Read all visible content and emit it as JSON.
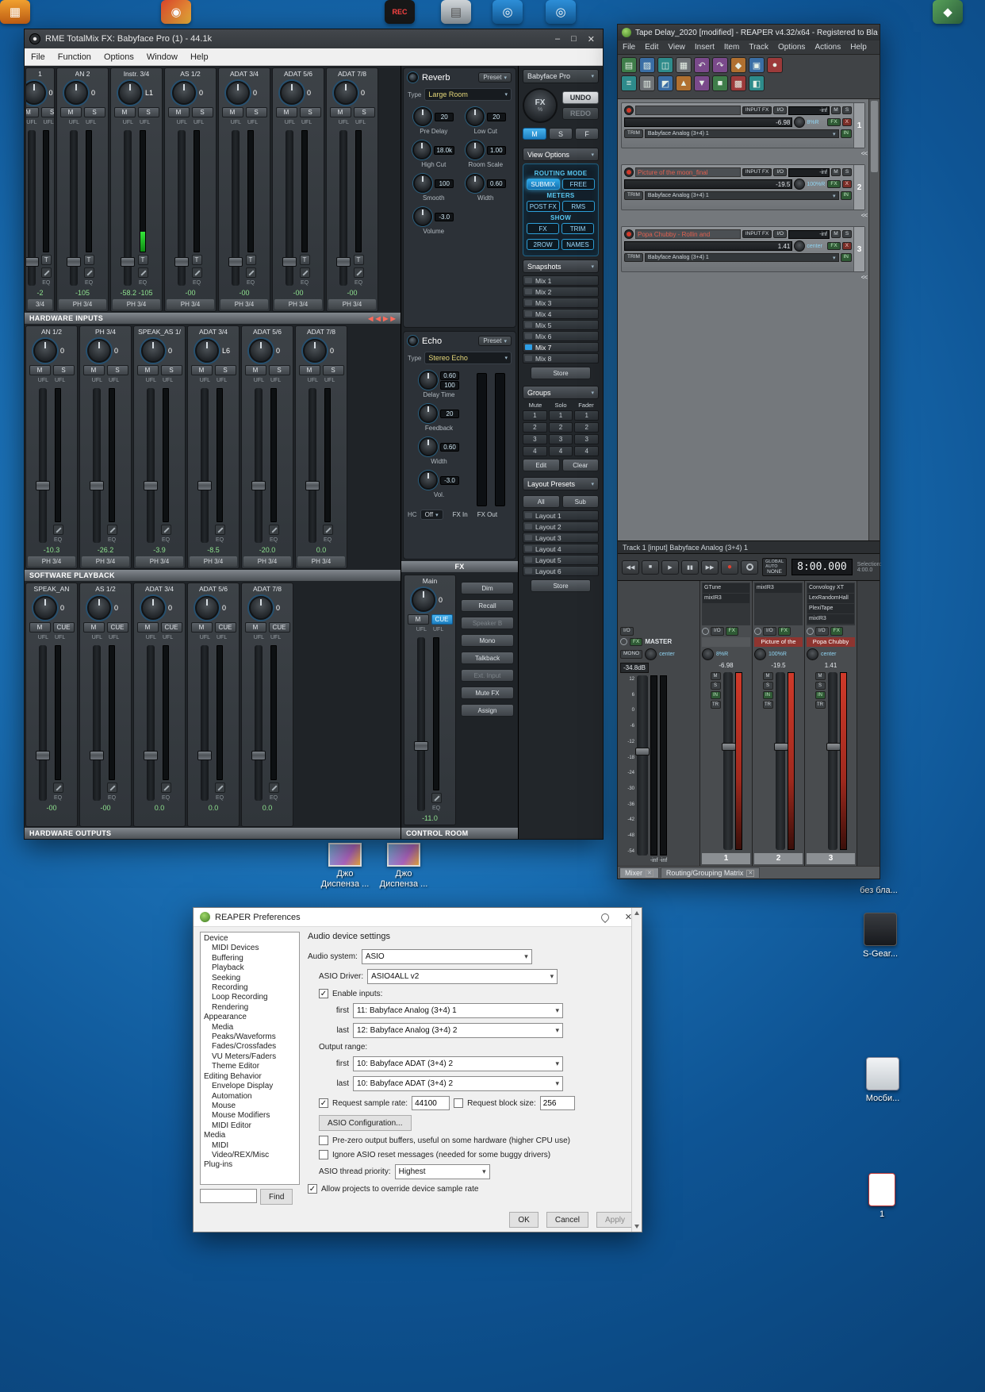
{
  "desktop": {
    "top_icons": [
      {
        "g": "◉",
        "cls": "dk-red"
      },
      {
        "g": "REC",
        "cls": "dk-black"
      },
      {
        "g": "▤",
        "cls": "dk-gray"
      },
      {
        "g": "◎",
        "cls": "dk-blue"
      },
      {
        "g": "◎",
        "cls": "dk-blue"
      },
      {
        "g": "◆",
        "cls": "dk-green"
      },
      {
        "g": "▦",
        "cls": "dk-orange"
      }
    ],
    "files": [
      {
        "label": "Джо Диспенза ..."
      },
      {
        "label": "Джо Диспенза ..."
      }
    ],
    "right_items": [
      {
        "label": "без бла..."
      },
      {
        "label": "S-Gear..."
      },
      {
        "label": "Мосби..."
      },
      {
        "label": "1"
      }
    ]
  },
  "totalmix": {
    "title": "RME TotalMix FX: Babyface Pro (1) - 44.1k",
    "window_buttons": [
      "–",
      "□",
      "✕"
    ],
    "menu": [
      "File",
      "Function",
      "Options",
      "Window",
      "Help"
    ],
    "labels": {
      "ufl": "UFL",
      "eq": "EQ",
      "t": "T",
      "m": "M",
      "s": "S",
      "cue": "CUE"
    },
    "sections": {
      "inputs": "HARDWARE INPUTS",
      "playback": "SOFTWARE PLAYBACK",
      "outputs": "HARDWARE OUTPUTS",
      "fx": "FX",
      "control_room": "CONTROL ROOM"
    },
    "input_channels": [
      {
        "name": "1",
        "gain": "0",
        "db": "-2",
        "out": "3/4",
        "cls": "cut"
      },
      {
        "name": "AN 2",
        "gain": "0",
        "db": "-105",
        "out": "PH 3/4"
      },
      {
        "name": "Instr. 3/4",
        "gain": "L1",
        "db": "-58.2 -105",
        "out": "PH 3/4",
        "cls": "lit"
      },
      {
        "name": "AS 1/2",
        "gain": "0",
        "db": "-00",
        "out": "PH 3/4"
      },
      {
        "name": "ADAT 3/4",
        "gain": "0",
        "db": "-00",
        "out": "PH 3/4"
      },
      {
        "name": "ADAT 5/6",
        "gain": "0",
        "db": "-00",
        "out": "PH 3/4"
      },
      {
        "name": "ADAT 7/8",
        "gain": "0",
        "db": "-00",
        "out": "PH 3/4"
      }
    ],
    "playback_channels": [
      {
        "name": "AN 1/2",
        "gain": "0",
        "db": "-10.3",
        "out": "PH 3/4"
      },
      {
        "name": "PH 3/4",
        "gain": "0",
        "db": "-26.2",
        "out": "PH 3/4"
      },
      {
        "name": "SPEAK_AS 1/",
        "gain": "0",
        "db": "-3.9",
        "out": "PH 3/4"
      },
      {
        "name": "ADAT 3/4",
        "gain": "L6",
        "db": "-8.5",
        "out": "PH 3/4"
      },
      {
        "name": "ADAT 5/6",
        "gain": "0",
        "db": "-20.0",
        "out": "PH 3/4"
      },
      {
        "name": "ADAT 7/8",
        "gain": "0",
        "db": "0.0",
        "out": "PH 3/4"
      }
    ],
    "output_channels": [
      {
        "name": "SPEAK_AN",
        "gain": "0",
        "db": "-00",
        "out": ""
      },
      {
        "name": "AS 1/2",
        "gain": "0",
        "db": "-00",
        "out": ""
      },
      {
        "name": "ADAT 3/4",
        "gain": "0",
        "db": "0.0",
        "out": ""
      },
      {
        "name": "ADAT 5/6",
        "gain": "0",
        "db": "0.0",
        "out": ""
      },
      {
        "name": "ADAT 7/8",
        "gain": "0",
        "db": "0.0",
        "out": ""
      }
    ],
    "reverb": {
      "title": "Reverb",
      "preset": "Preset",
      "type_label": "Type",
      "type": "Large Room",
      "knobs": [
        {
          "v": "20",
          "label": "Pre Delay"
        },
        {
          "v": "20",
          "label": "Low Cut"
        },
        {
          "v": "18.0k",
          "label": "High Cut"
        },
        {
          "v": "1.00",
          "label": "Room Scale"
        },
        {
          "v": "100",
          "label": "Smooth"
        },
        {
          "v": "0.60",
          "label": "Width"
        },
        {
          "v": "-3.0",
          "label": "Volume"
        }
      ]
    },
    "echo": {
      "title": "Echo",
      "preset": "Preset",
      "type_label": "Type",
      "type": "Stereo Echo",
      "knobs": [
        {
          "v": "0.60",
          "v2": "100",
          "label": "Delay Time"
        },
        {
          "v": "20",
          "label": "Feedback"
        },
        {
          "v": "0.60",
          "label": "Width"
        },
        {
          "v": "-3.0",
          "label": "Vol."
        }
      ],
      "hc_label": "HC",
      "hc": "Off",
      "meter_in": "FX In",
      "meter_out": "FX Out"
    },
    "control_room": {
      "name": "Main",
      "gain": "0",
      "db": "-11.0",
      "buttons": [
        {
          "label": "Dim"
        },
        {
          "label": "Recall"
        },
        {
          "label": "Speaker B",
          "cls": "dis"
        },
        {
          "label": "Mono"
        },
        {
          "label": "Talkback"
        },
        {
          "label": "Ext. Input",
          "cls": "dis"
        },
        {
          "label": "Mute FX"
        },
        {
          "label": "Assign"
        }
      ]
    },
    "right": {
      "device": "Babyface Pro",
      "fx": "FX",
      "pct": "%",
      "undo": "UNDO",
      "redo": "REDO",
      "msf": [
        {
          "label": "M",
          "cls": "active"
        },
        {
          "label": "S"
        },
        {
          "label": "F"
        }
      ],
      "view_options": "View Options",
      "routing_mode": "ROUTING MODE",
      "routing": [
        {
          "label": "SUBMIX",
          "cls": "active"
        },
        {
          "label": "FREE"
        }
      ],
      "meters_label": "METERS",
      "meters": [
        {
          "label": "POST FX"
        },
        {
          "label": "RMS"
        }
      ],
      "show_label": "SHOW",
      "show": [
        {
          "label": "FX",
          "cls": "half"
        },
        {
          "label": "TRIM",
          "cls": "half"
        },
        {
          "label": "2ROW",
          "cls": "half"
        },
        {
          "label": "NAMES",
          "cls": "half"
        }
      ],
      "snapshots": "Snapshots",
      "mixes": [
        {
          "label": "Mix 1"
        },
        {
          "label": "Mix 2"
        },
        {
          "label": "Mix 3"
        },
        {
          "label": "Mix 4"
        },
        {
          "label": "Mix 5"
        },
        {
          "label": "Mix 6"
        },
        {
          "label": "Mix 7",
          "cls": "sel"
        },
        {
          "label": "Mix 8"
        }
      ],
      "store": "Store",
      "groups": "Groups",
      "group_headers": [
        "Mute",
        "Solo",
        "Fader"
      ],
      "group_rows": [
        [
          "1",
          "1",
          "1"
        ],
        [
          "2",
          "2",
          "2"
        ],
        [
          "3",
          "3",
          "3"
        ],
        [
          "4",
          "4",
          "4"
        ]
      ],
      "edit": "Edit",
      "clear": "Clear",
      "layout_presets": "Layout Presets",
      "all": "All",
      "sub": "Sub",
      "layouts": [
        {
          "label": "Layout 1"
        },
        {
          "label": "Layout 2"
        },
        {
          "label": "Layout 3"
        },
        {
          "label": "Layout 4"
        },
        {
          "label": "Layout 5"
        },
        {
          "label": "Layout 6"
        }
      ],
      "store2": "Store"
    }
  },
  "reaper": {
    "title": "Tape Delay_2020 [modified] - REAPER v4.32/x64 - Registered to Bla",
    "menu": [
      "File",
      "Edit",
      "View",
      "Insert",
      "Item",
      "Track",
      "Options",
      "Actions",
      "Help"
    ],
    "toolbar_row1": [
      {
        "g": "▤",
        "cls": "tA"
      },
      {
        "g": "▨",
        "cls": "tB"
      },
      {
        "g": "◫",
        "cls": "tC"
      },
      {
        "g": "▦",
        "cls": "tD"
      },
      {
        "g": "↶",
        "cls": "tE"
      },
      {
        "g": "↷",
        "cls": "tE"
      },
      {
        "g": "◆",
        "cls": "tF"
      },
      {
        "g": "▣",
        "cls": "tB"
      },
      {
        "g": "●",
        "cls": "tG"
      }
    ],
    "toolbar_row2": [
      {
        "g": "≡",
        "cls": "tC"
      },
      {
        "g": "▥",
        "cls": "tD"
      },
      {
        "g": "◩",
        "cls": "tB"
      },
      {
        "g": "▲",
        "cls": "tF"
      },
      {
        "g": "▼",
        "cls": "tE"
      },
      {
        "g": "■",
        "cls": "tA"
      },
      {
        "g": "▩",
        "cls": "tG"
      },
      {
        "g": "◧",
        "cls": "tC"
      }
    ],
    "labels": {
      "input_fx": "INPUT FX",
      "io": "I/O",
      "m": "M",
      "s": "S",
      "fx": "FX",
      "x": "X",
      "in": "IN",
      "tr": "TR",
      "trim": "TRIM",
      "route": "Babyface Analog (3+4) 1"
    },
    "tracks": [
      {
        "name": "",
        "peak": "-inf",
        "vol": "-6.98",
        "pan": "8%R",
        "num": "1"
      },
      {
        "name": "Picture of the moon_final",
        "peak": "-inf",
        "vol": "-19.5",
        "pan": "100%R",
        "num": "2"
      },
      {
        "name": "Popa Chubby - Rollin and",
        "peak": "-inf",
        "vol": "1.41",
        "pan": "center",
        "num": "3"
      }
    ],
    "collapse": "<<",
    "status": "Track 1 [input] Babyface Analog (3+4) 1",
    "transport": {
      "global_auto": "GLOBAL AUTO",
      "auto": "NONE",
      "time": "8:00.000",
      "selection": "Selection: 4:00.0"
    },
    "transport_buttons": [
      {
        "g": "◀◀"
      },
      {
        "g": "■"
      },
      {
        "g": "▶"
      },
      {
        "g": "▮▮"
      },
      {
        "g": "▶▶"
      },
      {
        "g": "●",
        "cls": "rec"
      },
      {
        "g": "",
        "cls": "loop"
      }
    ],
    "mixer": {
      "master": {
        "io": "I/O",
        "fx": "FX",
        "label": "MASTER",
        "mono": "MONO",
        "pan": "center",
        "db": "-34.8dB",
        "peaks": "-inf  -inf",
        "scale": [
          "12",
          "6",
          "0",
          "-6",
          "-12",
          "-18",
          "-24",
          "-30",
          "-36",
          "-42",
          "-48",
          "-54"
        ]
      },
      "strips": [
        {
          "num": "1",
          "name": "",
          "pan": "8%R",
          "db": "-6.98",
          "fx": [
            "GTune",
            "mixIR3"
          ]
        },
        {
          "num": "2",
          "name": "Picture of the",
          "pan": "100%R",
          "db": "-19.5",
          "fx": [
            "mixIR3"
          ]
        },
        {
          "num": "3",
          "name": "Popa Chubby",
          "pan": "center",
          "db": "1.41",
          "fx": [
            "Convology XT",
            "LexRandomHall",
            "PlexiTape",
            "mixIR3"
          ]
        }
      ],
      "tabs": [
        {
          "label": "Mixer",
          "cls": "active"
        },
        {
          "label": "Routing/Grouping Matrix"
        }
      ]
    }
  },
  "prefs": {
    "title": "REAPER Preferences",
    "tree": [
      {
        "label": "Device"
      },
      {
        "label": "MIDI Devices",
        "cls": "ind"
      },
      {
        "label": "Buffering",
        "cls": "ind"
      },
      {
        "label": "Playback",
        "cls": "ind"
      },
      {
        "label": "Seeking",
        "cls": "ind"
      },
      {
        "label": "Recording",
        "cls": "ind"
      },
      {
        "label": "Loop Recording",
        "cls": "ind"
      },
      {
        "label": "Rendering",
        "cls": "ind"
      },
      {
        "label": "Appearance"
      },
      {
        "label": "Media",
        "cls": "ind"
      },
      {
        "label": "Peaks/Waveforms",
        "cls": "ind"
      },
      {
        "label": "Fades/Crossfades",
        "cls": "ind"
      },
      {
        "label": "VU Meters/Faders",
        "cls": "ind"
      },
      {
        "label": "Theme Editor",
        "cls": "ind"
      },
      {
        "label": "Editing Behavior"
      },
      {
        "label": "Envelope Display",
        "cls": "ind"
      },
      {
        "label": "Automation",
        "cls": "ind"
      },
      {
        "label": "Mouse",
        "cls": "ind"
      },
      {
        "label": "Mouse Modifiers",
        "cls": "ind"
      },
      {
        "label": "MIDI Editor",
        "cls": "ind"
      },
      {
        "label": "Media"
      },
      {
        "label": "MIDI",
        "cls": "ind"
      },
      {
        "label": "Video/REX/Misc",
        "cls": "ind"
      },
      {
        "label": "Plug-ins"
      }
    ],
    "find": "Find",
    "heading": "Audio device settings",
    "audio_system_label": "Audio system:",
    "audio_system": "ASIO",
    "asio_driver_label": "ASIO Driver:",
    "asio_driver": "ASIO4ALL v2",
    "enable_inputs": "Enable inputs:",
    "first": "first",
    "last": "last",
    "input_first": "11: Babyface Analog (3+4) 1",
    "input_last": "12: Babyface Analog (3+4) 2",
    "output_range": "Output range:",
    "output_first": "10: Babyface ADAT (3+4) 2",
    "output_last": "10: Babyface ADAT (3+4) 2",
    "request_sample_rate": "Request sample rate:",
    "sample_rate": "44100",
    "request_block_size": "Request block size:",
    "block_size": "256",
    "asio_config": "ASIO Configuration...",
    "prezero": "Pre-zero output buffers, useful on some hardware (higher CPU use)",
    "ignore_reset": "Ignore ASIO reset messages (needed for some buggy drivers)",
    "thread_priority_label": "ASIO thread priority:",
    "thread_priority": "Highest",
    "allow_override": "Allow projects to override device sample rate",
    "ok": "OK",
    "cancel": "Cancel",
    "apply": "Apply"
  }
}
